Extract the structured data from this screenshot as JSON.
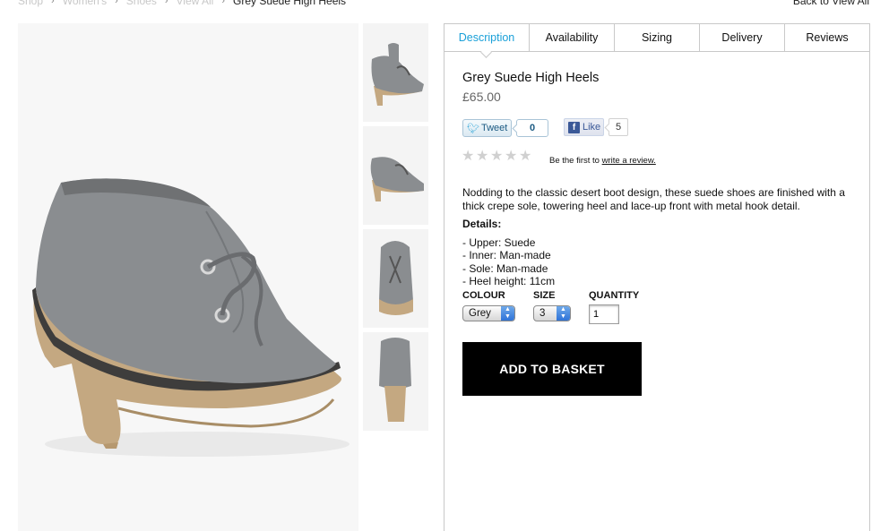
{
  "breadcrumb": {
    "items": [
      "Shop",
      "Women's",
      "Shoes",
      "View All"
    ],
    "current": "Grey Suede High Heels"
  },
  "back_link": "Back to View All",
  "tabs": [
    {
      "label": "Description",
      "active": true
    },
    {
      "label": "Availability",
      "active": false
    },
    {
      "label": "Sizing",
      "active": false
    },
    {
      "label": "Delivery",
      "active": false
    },
    {
      "label": "Reviews",
      "active": false
    }
  ],
  "product": {
    "title": "Grey Suede High Heels",
    "price": "£65.00",
    "rating_stars": 0,
    "rating_max": 5,
    "review_prompt": "Be the first to",
    "review_link": "write a review.",
    "description": "Nodding to the classic desert boot design, these suede shoes are finished with a thick crepe sole, towering heel and lace-up front with metal hook detail.",
    "details_heading": "Details:",
    "details": [
      "- Upper: Suede",
      "- Inner: Man-made",
      "- Sole: Man-made",
      "- Heel height: 11cm"
    ]
  },
  "social": {
    "tweet_label": "Tweet",
    "tweet_count": "0",
    "like_label": "Like",
    "like_count": "5"
  },
  "options": {
    "colour_label": "COLOUR",
    "colour_value": "Grey",
    "size_label": "SIZE",
    "size_value": "3",
    "quantity_label": "QUANTITY",
    "quantity_value": "1"
  },
  "add_to_basket": "ADD TO BASKET",
  "colors": {
    "active_tab": "#1aa0d8",
    "button_bg": "#000000",
    "suede": "#8a8d90",
    "sole": "#c4a881"
  },
  "icons": {
    "breadcrumb_separator": "chevron-right-icon",
    "tweet": "twitter-bird-icon",
    "like": "facebook-icon",
    "star": "star-icon",
    "select_arrow": "updown-arrows-icon"
  }
}
